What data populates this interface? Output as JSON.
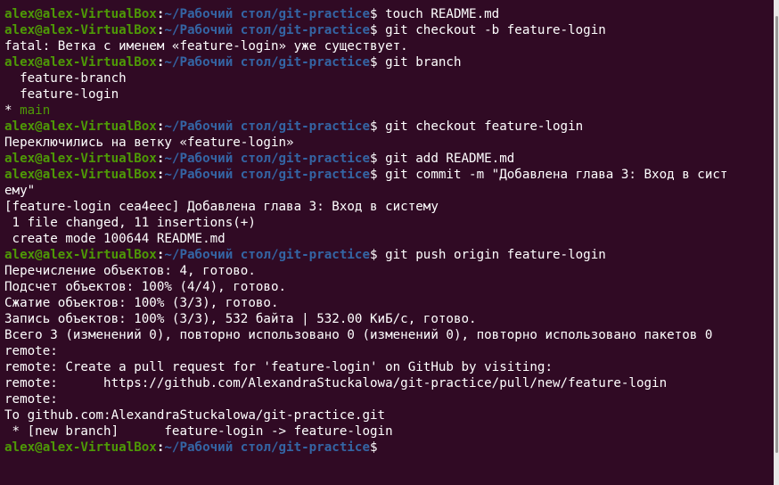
{
  "prompt": {
    "user": "alex@alex-VirtualBox",
    "colon": ":",
    "path": "~/Рабочий стол/git-practice",
    "dollar": "$"
  },
  "lines": [
    {
      "type": "prompt",
      "cmd": " touch README.md"
    },
    {
      "type": "prompt",
      "cmd": " git checkout -b feature-login"
    },
    {
      "type": "output",
      "text": "fatal: Ветка с именем «feature-login» уже существует."
    },
    {
      "type": "prompt",
      "cmd": " git branch"
    },
    {
      "type": "output",
      "text": "  feature-branch"
    },
    {
      "type": "output",
      "text": "  feature-login"
    },
    {
      "type": "current-branch",
      "marker": "* ",
      "name": "main"
    },
    {
      "type": "prompt",
      "cmd": " git checkout feature-login"
    },
    {
      "type": "output",
      "text": "Переключились на ветку «feature-login»"
    },
    {
      "type": "prompt",
      "cmd": " git add README.md"
    },
    {
      "type": "prompt",
      "cmd": " git commit -m \"Добавлена глава 3: Вход в сист"
    },
    {
      "type": "output",
      "text": "ему\""
    },
    {
      "type": "output",
      "text": "[feature-login cea4eec] Добавлена глава 3: Вход в систему"
    },
    {
      "type": "output",
      "text": " 1 file changed, 11 insertions(+)"
    },
    {
      "type": "output",
      "text": " create mode 100644 README.md"
    },
    {
      "type": "prompt",
      "cmd": " git push origin feature-login"
    },
    {
      "type": "output",
      "text": "Перечисление объектов: 4, готово."
    },
    {
      "type": "output",
      "text": "Подсчет объектов: 100% (4/4), готово."
    },
    {
      "type": "output",
      "text": "Сжатие объектов: 100% (3/3), готово."
    },
    {
      "type": "output",
      "text": "Запись объектов: 100% (3/3), 532 байта | 532.00 КиБ/с, готово."
    },
    {
      "type": "output",
      "text": "Всего 3 (изменений 0), повторно использовано 0 (изменений 0), повторно использовано пакетов 0"
    },
    {
      "type": "output",
      "text": "remote:"
    },
    {
      "type": "output",
      "text": "remote: Create a pull request for 'feature-login' on GitHub by visiting:"
    },
    {
      "type": "output",
      "text": "remote:      https://github.com/AlexandraStuckalowa/git-practice/pull/new/feature-login"
    },
    {
      "type": "output",
      "text": "remote:"
    },
    {
      "type": "output",
      "text": "To github.com:AlexandraStuckalowa/git-practice.git"
    },
    {
      "type": "output",
      "text": " * [new branch]      feature-login -> feature-login"
    },
    {
      "type": "prompt",
      "cmd": ""
    }
  ],
  "colors": {
    "background": "#300a24",
    "prompt_user": "#4e9a06",
    "prompt_path": "#3465a4",
    "text": "#ffffff"
  }
}
